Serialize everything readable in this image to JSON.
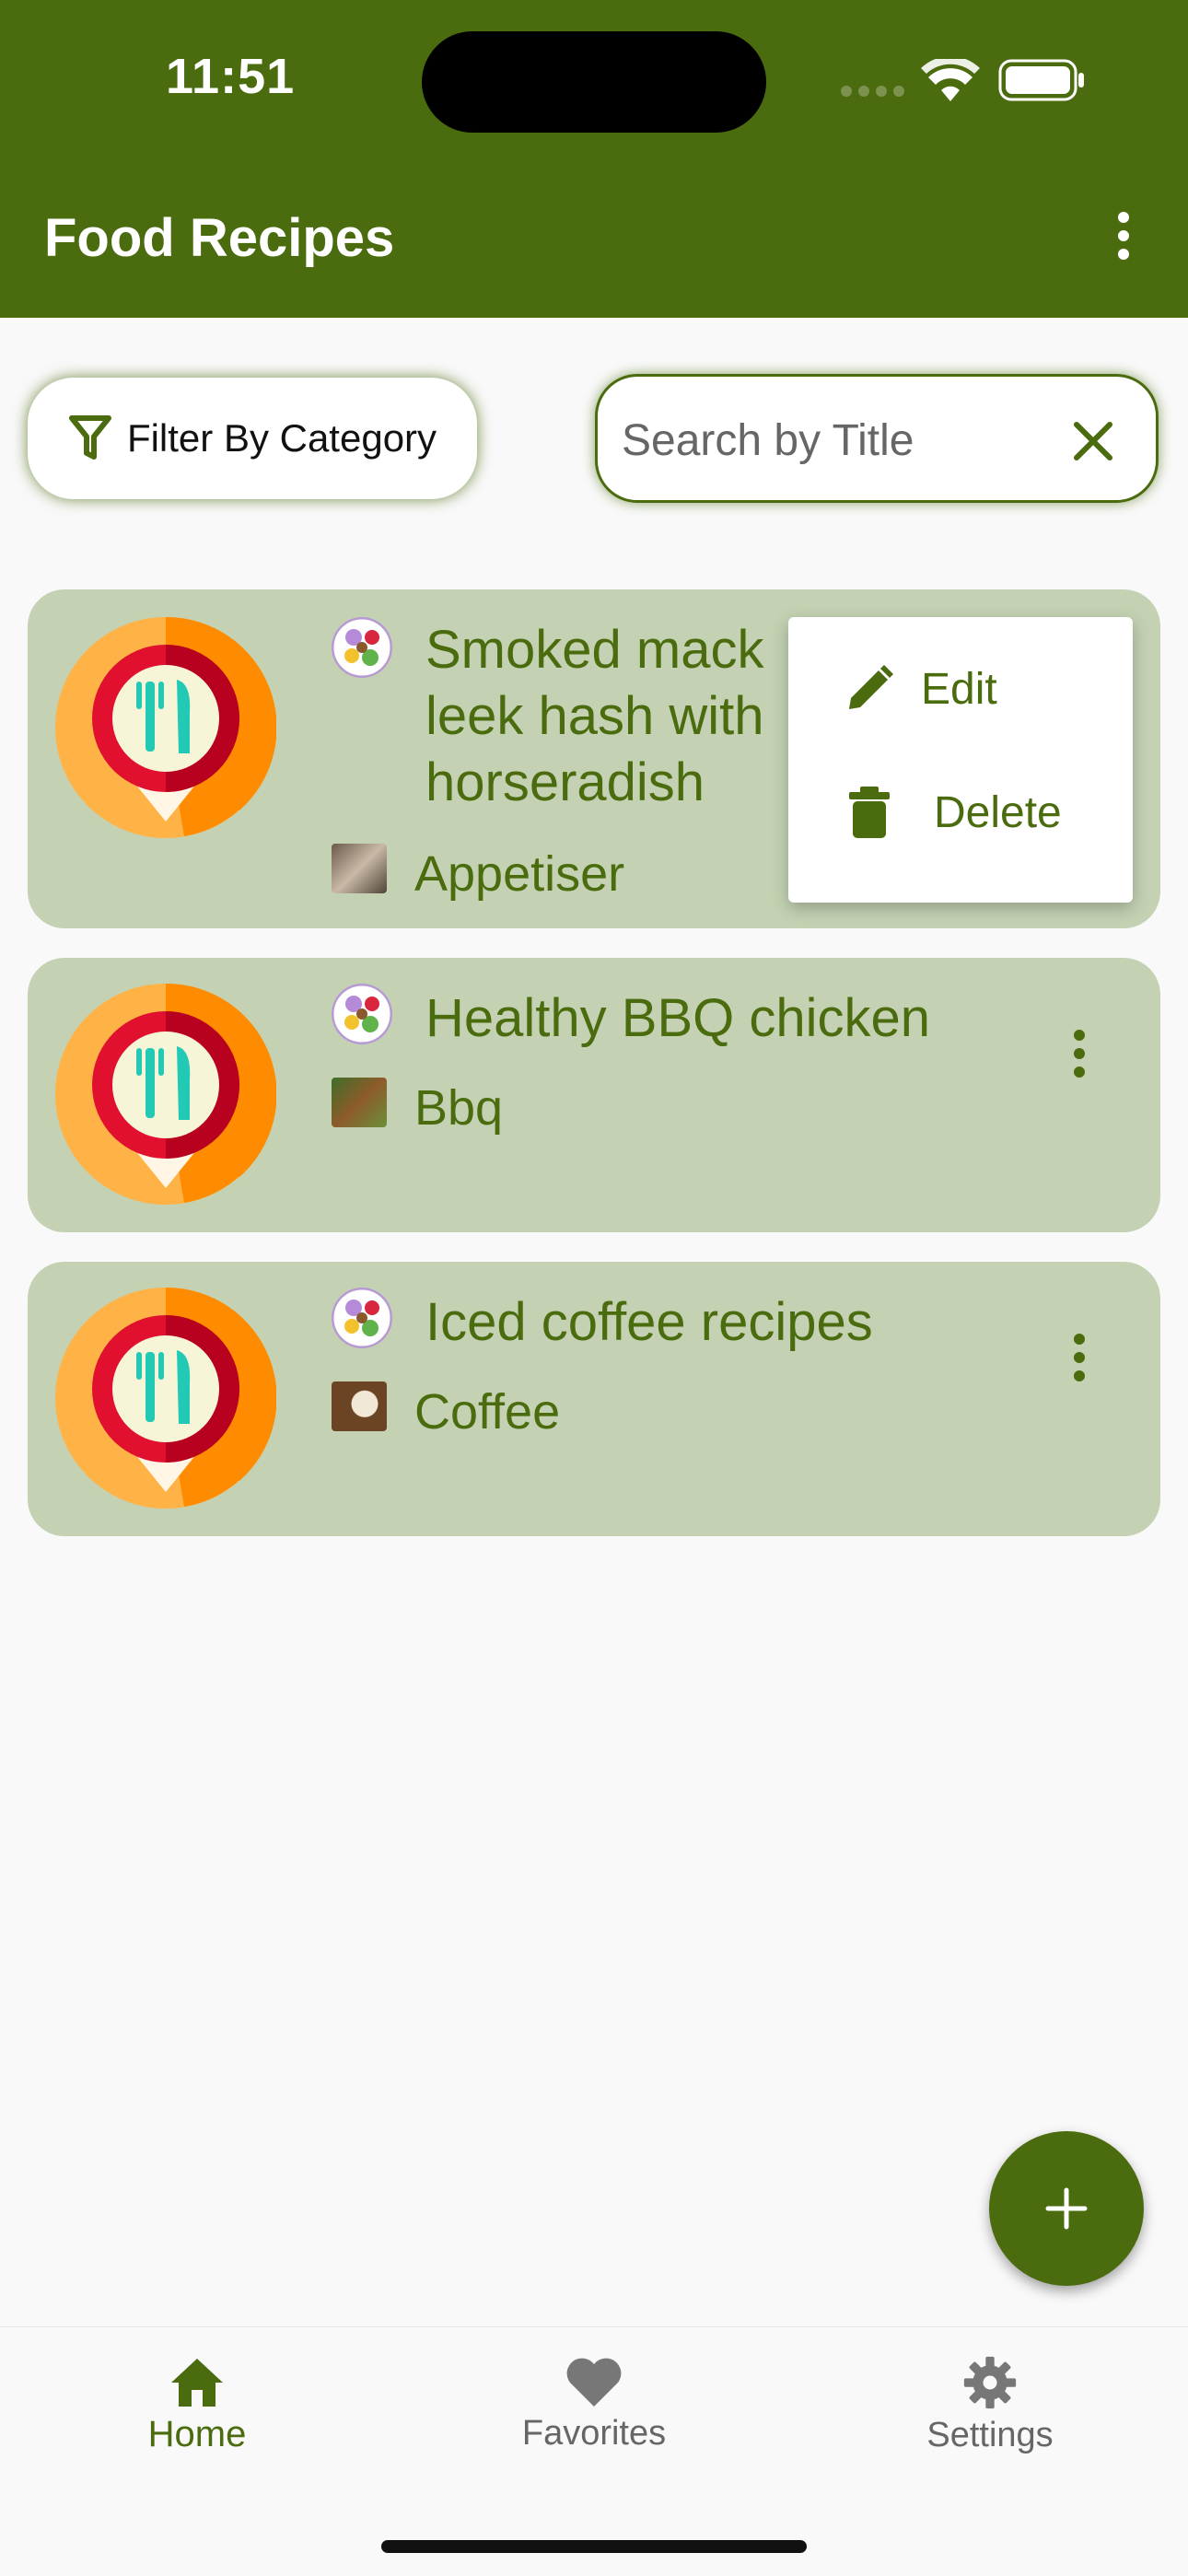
{
  "status_bar": {
    "time": "11:51"
  },
  "app_bar": {
    "title": "Food Recipes"
  },
  "filter": {
    "label": "Filter By Category"
  },
  "search": {
    "placeholder": "Search by Title",
    "value": ""
  },
  "recipes": [
    {
      "title": "Smoked mackerel & leek hash with horseradish",
      "visible_title": "Smoked mack\nleek hash with\nhorseradish",
      "category": "Appetiser"
    },
    {
      "title": "Healthy BBQ chicken",
      "category": "Bbq"
    },
    {
      "title": "Iced coffee recipes",
      "category": "Coffee"
    }
  ],
  "context_menu": {
    "edit_label": "Edit",
    "delete_label": "Delete"
  },
  "bottom_nav": {
    "home": "Home",
    "favorites": "Favorites",
    "settings": "Settings"
  },
  "colors": {
    "primary": "#4a6b0e",
    "card": "#c4d2b3",
    "background": "#f9f9f9"
  }
}
